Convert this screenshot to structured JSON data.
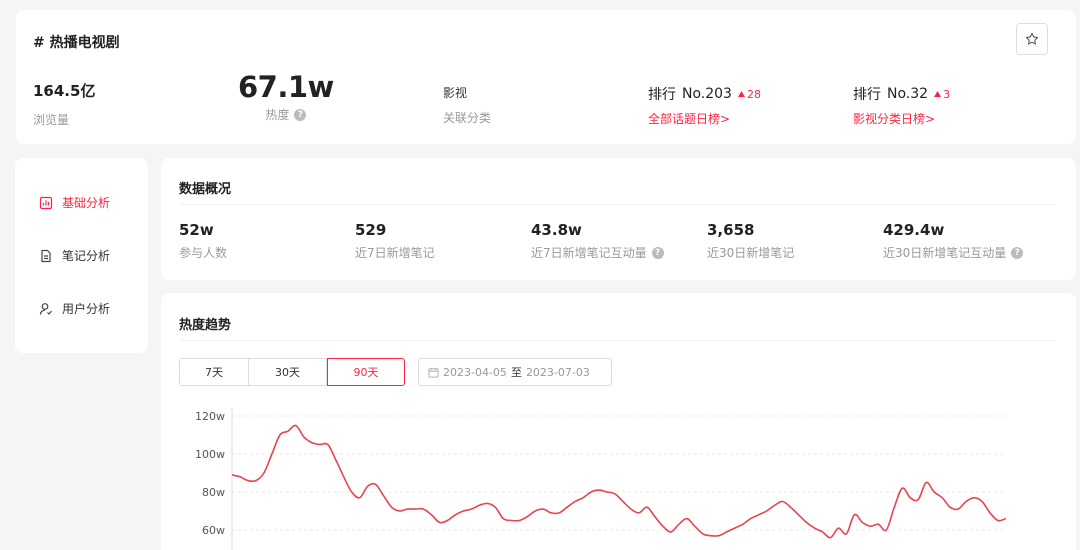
{
  "header": {
    "title": "# 热播电视剧",
    "stats": {
      "views": {
        "value": "164.5亿",
        "label": "浏览量"
      },
      "heat": {
        "value": "67.1w",
        "label": "热度"
      },
      "category": {
        "value": "影视",
        "label": "关联分类"
      }
    },
    "ranks": [
      {
        "prefix": "排行",
        "value": "No.203",
        "delta": "28",
        "link": "全部话题日榜>"
      },
      {
        "prefix": "排行",
        "value": "No.32",
        "delta": "3",
        "link": "影视分类日榜>"
      }
    ],
    "star_icon": "star-icon"
  },
  "sidebar": {
    "items": [
      {
        "label": "基础分析",
        "icon": "bar-chart-icon",
        "active": true
      },
      {
        "label": "笔记分析",
        "icon": "document-icon",
        "active": false
      },
      {
        "label": "用户分析",
        "icon": "user-icon",
        "active": false
      }
    ]
  },
  "overview": {
    "title": "数据概况",
    "metrics": [
      {
        "value": "52w",
        "label": "参与人数",
        "help": false
      },
      {
        "value": "529",
        "label": "近7日新增笔记",
        "help": false
      },
      {
        "value": "43.8w",
        "label": "近7日新增笔记互动量",
        "help": true
      },
      {
        "value": "3,658",
        "label": "近30日新增笔记",
        "help": false
      },
      {
        "value": "429.4w",
        "label": "近30日新增笔记互动量",
        "help": true
      }
    ]
  },
  "trend": {
    "title": "热度趋势",
    "ranges": [
      "7天",
      "30天",
      "90天"
    ],
    "active_range": "90天",
    "date_start": "2023-04-05",
    "date_sep": "至",
    "date_end": "2023-07-03"
  },
  "colors": {
    "accent": "#ff2442",
    "line": "#e8434f"
  },
  "chart_data": {
    "type": "line",
    "x_start": "2023-04-05",
    "x_end": "2023-07-03",
    "ylim": [
      40,
      120
    ],
    "yticks": [
      "120w",
      "100w",
      "80w",
      "60w"
    ],
    "ytick_values": [
      120,
      100,
      80,
      60
    ],
    "grid": true,
    "series": [
      {
        "values": [
          89,
          88,
          86,
          86,
          90,
          100,
          110,
          112,
          115,
          109,
          106,
          105,
          105,
          97,
          88,
          80,
          77,
          83,
          84,
          78,
          72,
          70,
          71,
          71,
          71,
          68,
          64,
          65,
          68,
          70,
          71,
          73,
          74,
          72,
          66,
          65,
          65,
          67,
          70,
          71,
          69,
          69,
          72,
          75,
          77,
          80,
          81,
          80,
          79,
          75,
          71,
          69,
          72,
          67,
          62,
          59,
          63,
          66,
          62,
          58,
          57,
          57,
          59,
          61,
          63,
          66,
          68,
          70,
          73,
          75,
          72,
          68,
          64,
          61,
          59,
          56,
          61,
          58,
          68,
          64,
          62,
          63,
          60,
          72,
          82,
          77,
          76,
          85,
          80,
          77,
          72,
          71,
          75,
          77,
          75,
          69,
          65,
          66
        ]
      }
    ]
  }
}
